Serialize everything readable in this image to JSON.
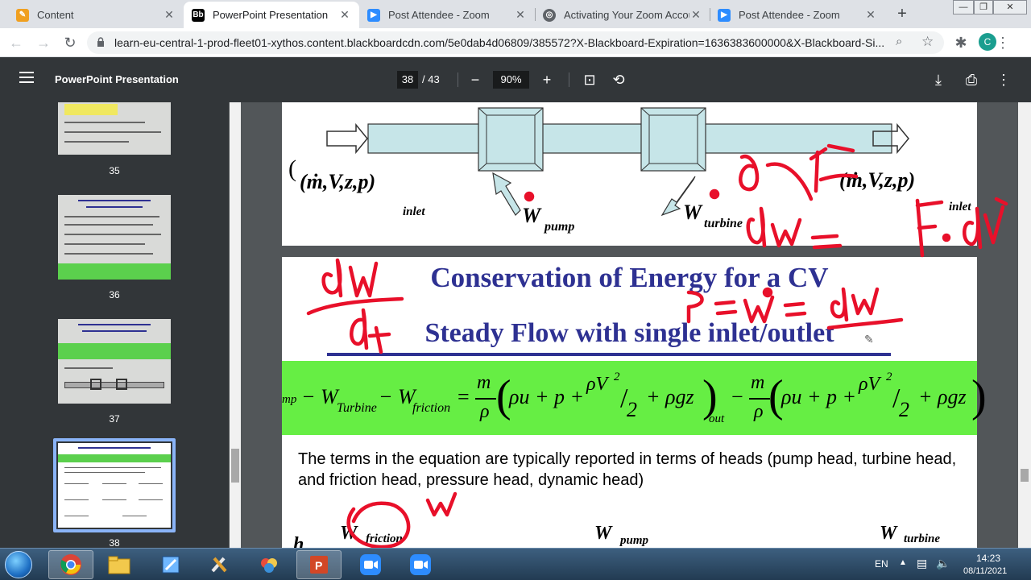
{
  "browser": {
    "tabs": [
      {
        "title": "Content",
        "active": false,
        "favicon": "pencil-icon",
        "color": "#f0a020"
      },
      {
        "title": "PowerPoint Presentation",
        "active": true,
        "favicon": "blackboard-icon",
        "color": "#000000"
      },
      {
        "title": "Post Attendee - Zoom",
        "active": false,
        "favicon": "zoom-icon",
        "color": "#2d8cff"
      },
      {
        "title": "Activating Your Zoom Accou",
        "active": false,
        "favicon": "globe-icon",
        "color": "#5f6368"
      },
      {
        "title": "Post Attendee - Zoom",
        "active": false,
        "favicon": "zoom-icon",
        "color": "#2d8cff"
      }
    ],
    "url": "learn-eu-central-1-prod-fleet01-xythos.content.blackboardcdn.com/5e0dab4d06809/385572?X-Blackboard-Expiration=1636383600000&X-Blackboard-Si...",
    "profile_initial": "C"
  },
  "pdf_viewer": {
    "title": "PowerPoint Presentation",
    "current_page": "38",
    "total_pages": "/ 43",
    "zoom": "90%"
  },
  "thumbnails": [
    {
      "page": "35"
    },
    {
      "page": "36"
    },
    {
      "page": "37"
    },
    {
      "page": "38",
      "selected": true
    }
  ],
  "slide_top": {
    "inlet_state": "(ṁ,V,z,p)",
    "inlet_sub": "inlet",
    "outlet_state": "(ṁ,V,z,p)",
    "outlet_sub": "inlet",
    "w_pump": "W",
    "w_pump_sub": "pump",
    "w_turbine": "W",
    "w_turbine_sub": "turbine"
  },
  "slide_main": {
    "title": "Conservation of Energy for a CV",
    "subtitle": "Steady Flow with single inlet/outlet",
    "equation_left": "mp  − W",
    "eq_turbine_sub": "Turbine",
    "eq_minus": "− W",
    "eq_friction_sub": "friction",
    "eq_out_sub": "out",
    "body": "The terms in the equation are typically reported in terms of heads (pump head, turbine head, and friction head, pressure head, dynamic head)",
    "bottom_friction": "W",
    "bottom_friction_sub": "friction",
    "bottom_pump": "W",
    "bottom_pump_sub": "pump",
    "bottom_turbine": "W",
    "bottom_turbine_sub": "turbine",
    "bottom_lead": "h"
  },
  "annotations": {
    "ink_color": "#e8102a",
    "texts": [
      "dW",
      "dt",
      "dW = F·dr",
      "P = Ẇ = dW",
      "W"
    ]
  },
  "taskbar": {
    "language": "EN",
    "time": "14:23",
    "date": "08/11/2021",
    "apps": [
      "chrome-icon",
      "file-explorer-icon",
      "paint-icon",
      "tools-icon",
      "games-icon",
      "powerpoint-icon",
      "zoom-icon",
      "zoom-meeting-icon"
    ]
  },
  "colors": {
    "slide_title": "#2e3192",
    "green_band": "#66ee44",
    "pipe_fill": "#c6e5e8"
  }
}
